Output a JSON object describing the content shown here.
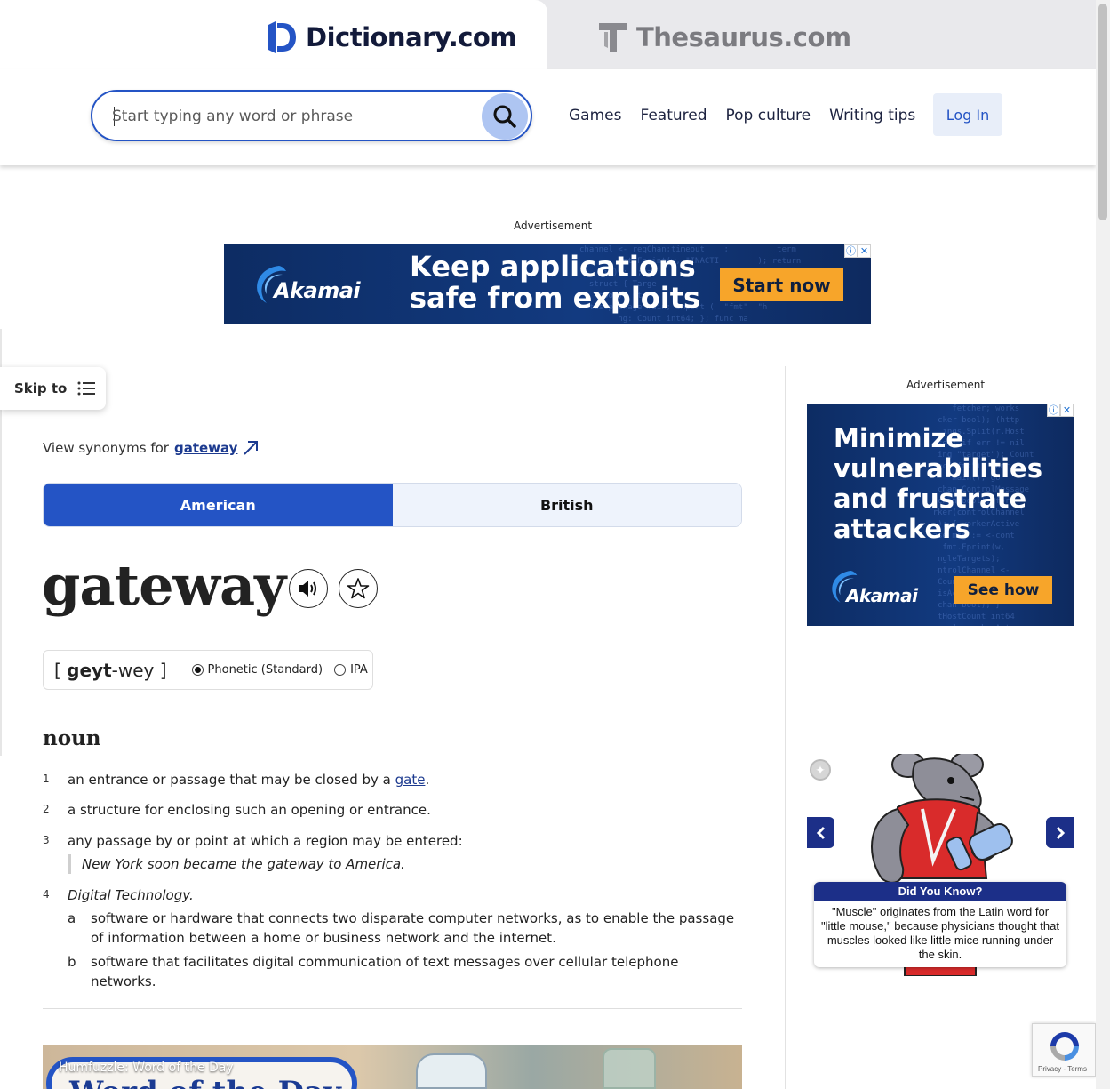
{
  "site_tabs": {
    "dictionary_label": "Dictionary.com",
    "thesaurus_label": "Thesaurus.com"
  },
  "header": {
    "search_placeholder": "Start typing any word or phrase",
    "nav": [
      "Games",
      "Featured",
      "Pop culture",
      "Writing tips"
    ],
    "login_label": "Log In"
  },
  "top_ad": {
    "label": "Advertisement",
    "brand": "Akamai",
    "headline_1": "Keep applications",
    "headline_2": "safe from exploits",
    "cta": "Start now"
  },
  "side_ad": {
    "label": "Advertisement",
    "brand": "Akamai",
    "headline_lines": [
      "Minimize",
      "vulnerabilities",
      "and frustrate",
      "attackers"
    ],
    "cta": "See how"
  },
  "skip": {
    "label": "Skip to"
  },
  "entry": {
    "synonyms_prefix": "View synonyms for",
    "synonyms_word": "gateway",
    "dialect_tabs": [
      "American",
      "British"
    ],
    "active_dialect": "American",
    "headword": "gateway",
    "pronunciation_open": "[ ",
    "pronunciation_stressed": "geyt",
    "pronunciation_rest": "-wey ]",
    "pron_options": [
      "Phonetic (Standard)",
      "IPA"
    ],
    "pron_selected": "Phonetic (Standard)",
    "part_of_speech": "noun",
    "definitions": [
      {
        "num": "1",
        "text_before": "an entrance or passage that may be closed by a ",
        "link": "gate",
        "text_after": "."
      },
      {
        "num": "2",
        "text": "a structure for enclosing such an opening or entrance."
      },
      {
        "num": "3",
        "text": "any passage by or point at which a region may be entered:",
        "example": "New York soon became the gateway to America."
      },
      {
        "num": "4",
        "label": "Digital Technology.",
        "subs": [
          {
            "letter": "a",
            "text": "software or hardware that connects two disparate computer networks, as to enable the passage of information between a home or business network and the internet."
          },
          {
            "letter": "b",
            "text": "software that facilitates digital communication of text messages over cellular telephone networks."
          }
        ]
      }
    ]
  },
  "wotd": {
    "small_label": "Humfuzzle: Word of the Day",
    "big_label": "Word of the Day"
  },
  "did_you_know": {
    "title": "Did You Know?",
    "body": "\"Muscle\" originates from the Latin word for \"little mouse,\" because physicians thought that muscles looked like little mice running under the skin."
  },
  "recaptcha": {
    "links": "Privacy - Terms"
  },
  "colors": {
    "brand_blue": "#2454c5",
    "navy": "#1c2f88",
    "ad_orange": "#f7a52a"
  }
}
